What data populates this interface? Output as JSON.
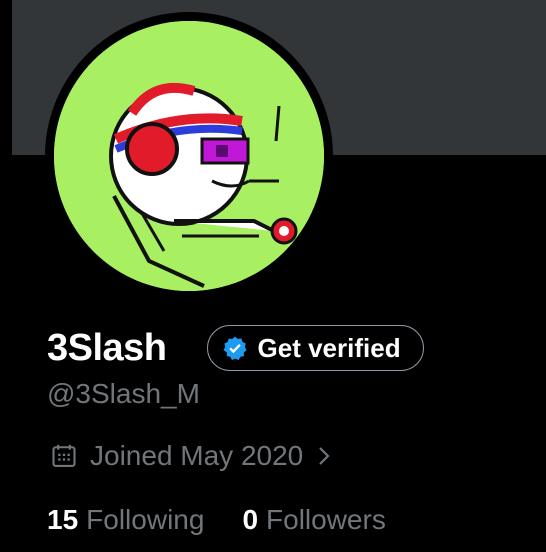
{
  "profile": {
    "display_name": "3Slash",
    "handle": "@3Slash_M",
    "verify_button_label": "Get verified",
    "joined_text": "Joined May 2020",
    "following_count": "15",
    "following_label": "Following",
    "followers_count": "0",
    "followers_label": "Followers"
  },
  "icons": {
    "verify": "verified-badge-icon",
    "calendar": "calendar-icon",
    "chevron": "chevron-right-icon"
  },
  "colors": {
    "background": "#000000",
    "banner": "#333639",
    "avatar_bg": "#a8f062",
    "verified_blue": "#1d9bf0",
    "muted_text": "#71767b"
  }
}
